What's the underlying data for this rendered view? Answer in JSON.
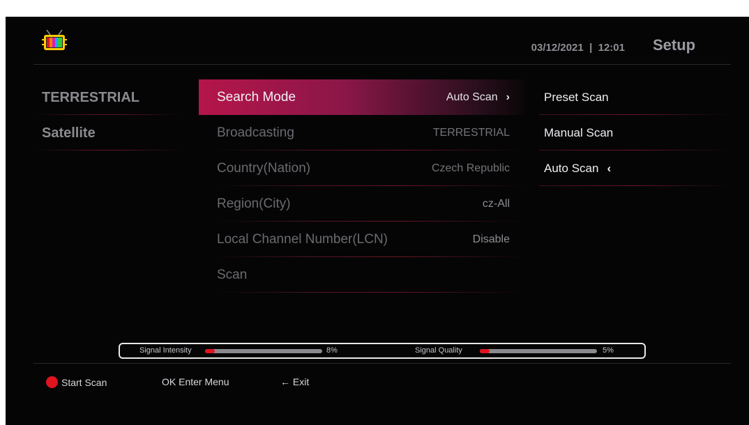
{
  "header": {
    "date": "03/12/2021",
    "separator": "|",
    "time": "12:01",
    "title": "Setup"
  },
  "left_tabs": [
    {
      "label": "TERRESTRIAL"
    },
    {
      "label": "Satellite"
    }
  ],
  "menu": [
    {
      "label": "Search Mode",
      "value": "Auto Scan",
      "chevron": "›"
    },
    {
      "label": "Broadcasting",
      "value": "TERRESTRIAL"
    },
    {
      "label": "Country(Nation)",
      "value": "Czech Republic"
    },
    {
      "label": "Region(City)",
      "value": "cz-All"
    },
    {
      "label": "Local Channel Number(LCN)",
      "value": "Disable"
    },
    {
      "label": "Scan",
      "value": ""
    }
  ],
  "submenu": [
    {
      "label": "Preset Scan"
    },
    {
      "label": "Manual Scan"
    },
    {
      "label": "Auto Scan",
      "chevron": "‹"
    }
  ],
  "signal": {
    "intensity_label": "Signal Intensity",
    "intensity_value": "8%",
    "intensity_fraction": 0.08,
    "quality_label": "Signal Quality",
    "quality_value": "5%",
    "quality_fraction": 0.05
  },
  "footer": {
    "start_scan": "Start Scan",
    "ok_key": "OK",
    "enter_menu": "Enter Menu",
    "exit_arrow": "←",
    "exit": "Exit"
  },
  "colors": {
    "accent": "#e0141f",
    "highlight": "#b5154a"
  }
}
